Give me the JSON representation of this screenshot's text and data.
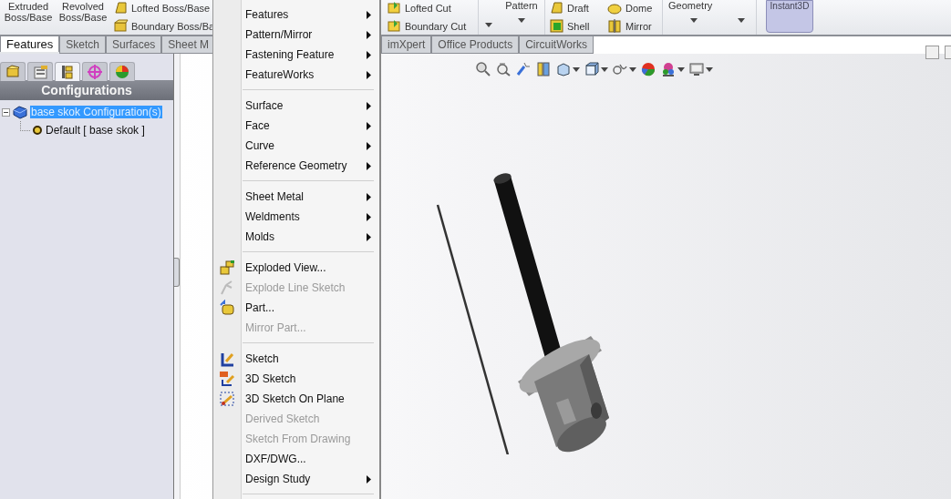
{
  "ribbon": {
    "left_large": [
      "Extruded Boss/Base",
      "Revolved Boss/Base"
    ],
    "left_small": [
      "Lofted Boss/Base",
      "Boundary Boss/Ba"
    ],
    "cut_small": [
      "Lofted Cut",
      "Boundary Cut"
    ],
    "pattern_label": "Pattern",
    "feature_columns": [
      [
        "Draft",
        "Shell"
      ],
      [
        "Dome",
        "Mirror"
      ]
    ],
    "geometry_label": "Geometry",
    "instant3d": {
      "label": "Instant3D",
      "on": true
    }
  },
  "command_tabs": {
    "before_menu": [
      {
        "label": "Features",
        "selected": true
      },
      {
        "label": "Sketch",
        "selected": false
      },
      {
        "label": "Surfaces",
        "selected": false
      },
      {
        "label": "Sheet M",
        "selected": false
      }
    ],
    "after_menu": [
      {
        "label": "imXpert",
        "selected": false
      },
      {
        "label": "Office Products",
        "selected": false
      },
      {
        "label": "CircuitWorks",
        "selected": false
      }
    ]
  },
  "manager_tabs": [
    {
      "selected": false
    },
    {
      "selected": false
    },
    {
      "selected": true
    },
    {
      "selected": false
    },
    {
      "selected": false
    }
  ],
  "manager_title": "Configurations",
  "tree": [
    {
      "label": "base skok Configuration(s)",
      "selected": true,
      "expanded": true,
      "children": [
        {
          "label": "Default [ base skok ]",
          "selected": false
        }
      ]
    }
  ],
  "menu": {
    "groups": [
      [
        {
          "label": "Features",
          "submenu": true,
          "disabled": false,
          "has_icon": false
        },
        {
          "label": "Pattern/Mirror",
          "submenu": true,
          "disabled": false,
          "has_icon": false
        },
        {
          "label": "Fastening Feature",
          "submenu": true,
          "disabled": false,
          "has_icon": false
        },
        {
          "label": "FeatureWorks",
          "submenu": true,
          "disabled": false,
          "has_icon": false
        }
      ],
      [
        {
          "label": "Surface",
          "submenu": true,
          "disabled": false,
          "has_icon": false
        },
        {
          "label": "Face",
          "submenu": true,
          "disabled": false,
          "has_icon": false
        },
        {
          "label": "Curve",
          "submenu": true,
          "disabled": false,
          "has_icon": false
        },
        {
          "label": "Reference Geometry",
          "submenu": true,
          "disabled": false,
          "has_icon": false
        }
      ],
      [
        {
          "label": "Sheet Metal",
          "submenu": true,
          "disabled": false,
          "has_icon": false
        },
        {
          "label": "Weldments",
          "submenu": true,
          "disabled": false,
          "has_icon": false
        },
        {
          "label": "Molds",
          "submenu": true,
          "disabled": false,
          "has_icon": false
        }
      ],
      [
        {
          "label": "Exploded View...",
          "submenu": false,
          "disabled": false,
          "has_icon": true
        },
        {
          "label": "Explode Line Sketch",
          "submenu": false,
          "disabled": true,
          "has_icon": true
        },
        {
          "label": "Part...",
          "submenu": false,
          "disabled": false,
          "has_icon": true
        },
        {
          "label": "Mirror Part...",
          "submenu": false,
          "disabled": true,
          "has_icon": false
        }
      ],
      [
        {
          "label": "Sketch",
          "submenu": false,
          "disabled": false,
          "has_icon": true
        },
        {
          "label": "3D Sketch",
          "submenu": false,
          "disabled": false,
          "has_icon": true
        },
        {
          "label": "3D Sketch On Plane",
          "submenu": false,
          "disabled": false,
          "has_icon": true
        },
        {
          "label": "Derived Sketch",
          "submenu": false,
          "disabled": true,
          "has_icon": false
        },
        {
          "label": "Sketch From Drawing",
          "submenu": false,
          "disabled": true,
          "has_icon": false
        },
        {
          "label": "DXF/DWG...",
          "submenu": false,
          "disabled": false,
          "has_icon": false
        },
        {
          "label": "Design Study",
          "submenu": true,
          "disabled": false,
          "has_icon": false
        }
      ]
    ]
  }
}
